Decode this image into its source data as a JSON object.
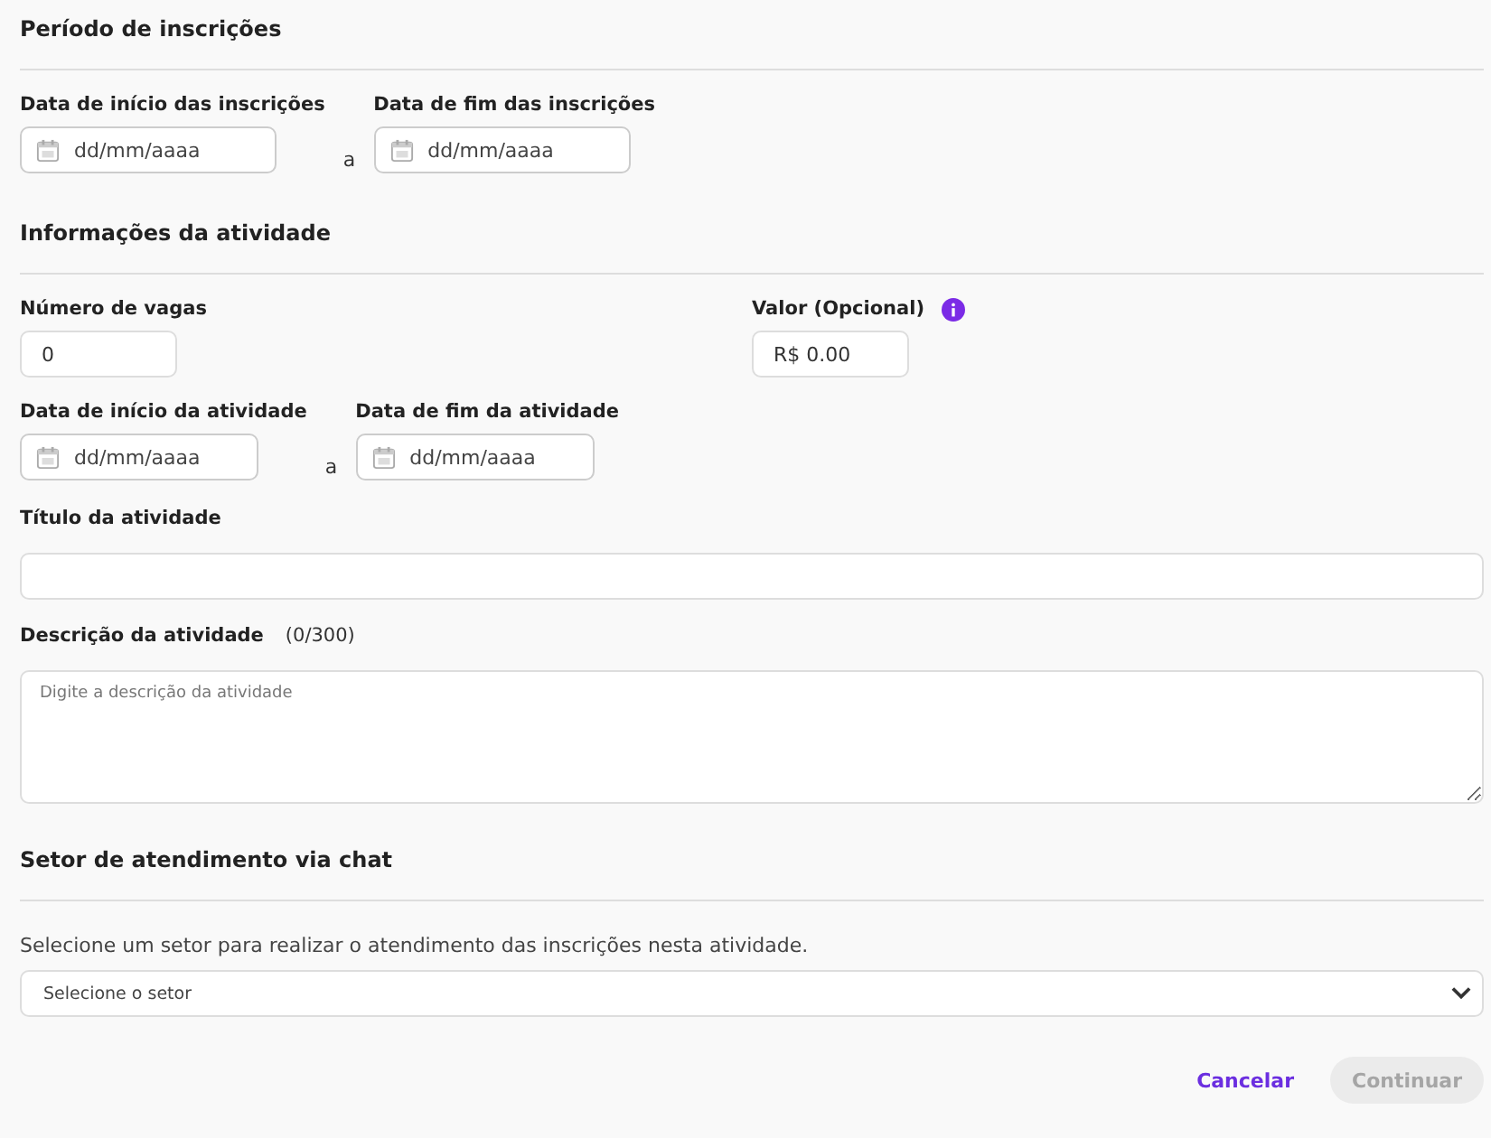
{
  "registration_period": {
    "heading": "Período de inscrições",
    "start": {
      "label": "Data de início das inscrições",
      "placeholder": "dd/mm/aaaa"
    },
    "separator": "a",
    "end": {
      "label": "Data de fim das inscrições",
      "placeholder": "dd/mm/aaaa"
    }
  },
  "activity_info": {
    "heading": "Informações da atividade",
    "spots": {
      "label": "Número de vagas",
      "value": "0"
    },
    "price": {
      "label": "Valor (Opcional)",
      "value": "R$ 0.00"
    },
    "start": {
      "label": "Data de início da atividade",
      "placeholder": "dd/mm/aaaa"
    },
    "separator": "a",
    "end": {
      "label": "Data de fim da atividade",
      "placeholder": "dd/mm/aaaa"
    },
    "title": {
      "label": "Título da atividade"
    },
    "description": {
      "label": "Descrição da atividade",
      "counter": "(0/300)",
      "placeholder": "Digite a descrição da atividade"
    }
  },
  "chat_sector": {
    "heading": "Setor de atendimento via chat",
    "hint": "Selecione um setor para realizar o atendimento das inscrições nesta atividade.",
    "select": {
      "placeholder": "Selecione o setor"
    }
  },
  "buttons": [
    {
      "label": "Cancelar",
      "kind": "link",
      "disabled": false
    },
    {
      "label": "Continuar",
      "kind": "primary",
      "disabled": true
    }
  ]
}
